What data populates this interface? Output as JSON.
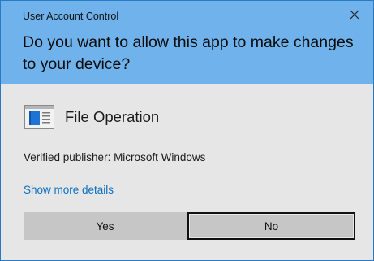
{
  "dialog": {
    "title": "User Account Control",
    "headline": "Do you want to allow this app to make changes to your device?",
    "app_name": "File Operation",
    "app_icon": "window-app-icon",
    "publisher": "Verified publisher: Microsoft Windows",
    "details_link": "Show more details",
    "buttons": {
      "yes": "Yes",
      "no": "No"
    },
    "colors": {
      "header": "#70b3ec",
      "body": "#e6e6e6",
      "link": "#0b6fc1",
      "button": "#c6c6c6"
    }
  }
}
